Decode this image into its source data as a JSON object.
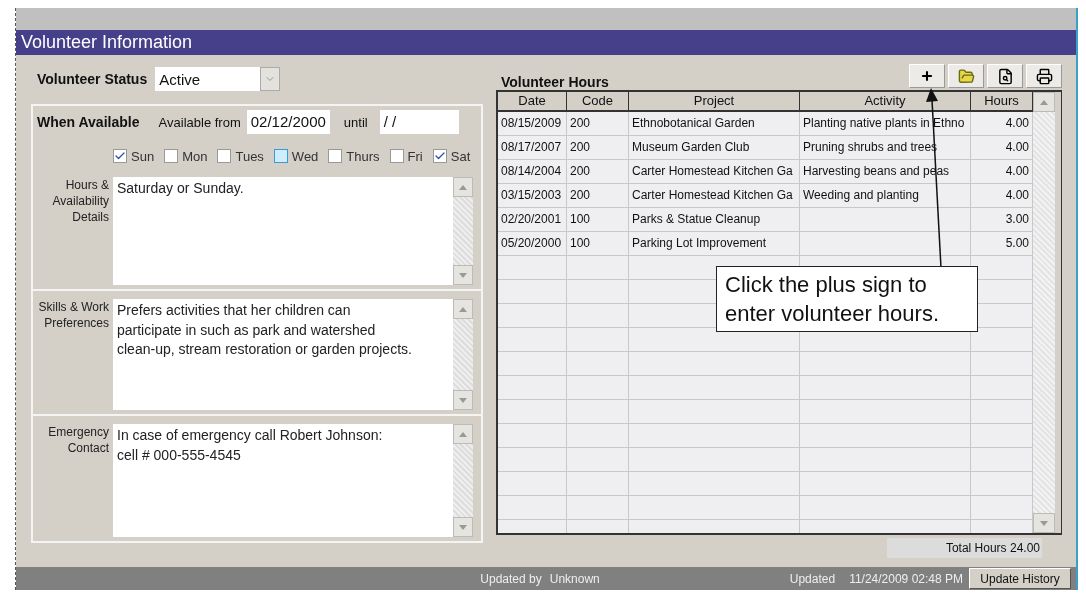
{
  "window": {
    "title": "Volunteer Information"
  },
  "volunteer_status": {
    "label": "Volunteer Status",
    "value": "Active"
  },
  "when_available": {
    "title": "When Available",
    "from_label": "Available from",
    "from_value": "02/12/2000",
    "until_label": "until",
    "until_value": "/  /"
  },
  "days": [
    {
      "label": "Sun",
      "checked": true,
      "highlighted": false
    },
    {
      "label": "Mon",
      "checked": false,
      "highlighted": false
    },
    {
      "label": "Tues",
      "checked": false,
      "highlighted": false
    },
    {
      "label": "Wed",
      "checked": false,
      "highlighted": true
    },
    {
      "label": "Thurs",
      "checked": false,
      "highlighted": false
    },
    {
      "label": "Fri",
      "checked": false,
      "highlighted": false
    },
    {
      "label": "Sat",
      "checked": true,
      "highlighted": false
    }
  ],
  "details": [
    {
      "label": "Hours & Availability Details",
      "lines": [
        "Saturday or Sunday."
      ]
    },
    {
      "label": "Skills & Work Preferences",
      "lines": [
        "Prefers activities that her children can",
        "participate in such as park and watershed",
        "clean-up, stream restoration or garden projects."
      ]
    },
    {
      "label": "Emergency Contact",
      "lines": [
        "In case of emergency call Robert Johnson:",
        "cell # 000-555-4545"
      ]
    }
  ],
  "hours": {
    "title": "Volunteer Hours",
    "columns": [
      "Date",
      "Code",
      "Project",
      "Activity",
      "Hours"
    ],
    "rows": [
      [
        "08/15/2009",
        "200",
        "Ethnobotanical Garden",
        "Planting native plants in Ethno",
        "4.00"
      ],
      [
        "08/17/2007",
        "200",
        "Museum Garden Club",
        "Pruning shrubs and trees",
        "4.00"
      ],
      [
        "08/14/2004",
        "200",
        "Carter Homestead Kitchen Ga",
        "Harvesting beans and peas",
        "4.00"
      ],
      [
        "03/15/2003",
        "200",
        "Carter Homestead Kitchen Ga",
        "Weeding and planting",
        "4.00"
      ],
      [
        "02/20/2001",
        "100",
        "Parks & Statue Cleanup",
        "",
        "3.00"
      ],
      [
        "05/20/2000",
        "100",
        "Parking Lot Improvement",
        "",
        "5.00"
      ]
    ],
    "total_label": "Total Hours",
    "total_value": "24.00"
  },
  "callout": {
    "text": "Click the plus sign to enter volunteer hours."
  },
  "status_bar": {
    "updated_by_label": "Updated by",
    "updated_by": "Unknown",
    "updated_label": "Updated",
    "updated_value": "11/24/2009 02:48 PM",
    "button": "Update History"
  }
}
